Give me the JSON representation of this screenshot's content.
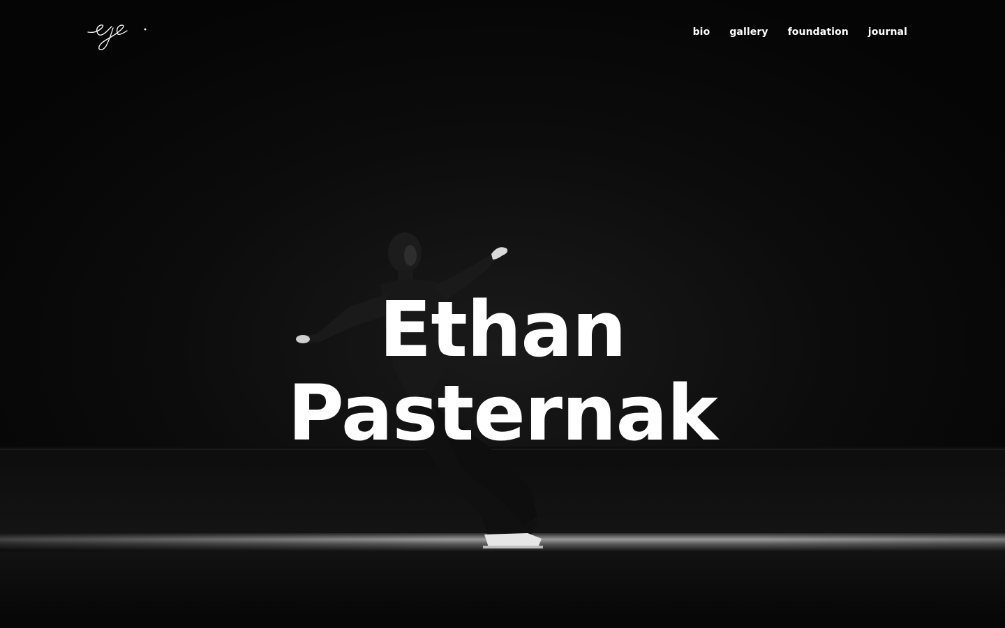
{
  "site": {
    "logo_text": "ep."
  },
  "nav": {
    "items": [
      {
        "label": "bio"
      },
      {
        "label": "gallery"
      },
      {
        "label": "foundation"
      },
      {
        "label": "journal"
      }
    ]
  },
  "hero": {
    "title_line1": "Ethan",
    "title_line2": "Pasternak"
  },
  "colors": {
    "background": "#070707",
    "text": "#ffffff",
    "ice": "#8c8c8c"
  },
  "icons": {
    "logo": "signature-logo-icon"
  }
}
